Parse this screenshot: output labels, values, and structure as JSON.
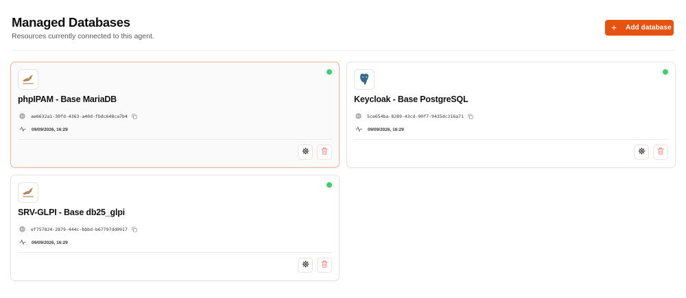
{
  "header": {
    "title": "Managed Databases",
    "subtitle": "Resources currently connected to this agent."
  },
  "toolbar": {
    "add_icon": "+",
    "add_label": "Add database"
  },
  "colors": {
    "accent": "#e8520f",
    "status_online": "#3fcf6d",
    "selected_border": "#e8b49c",
    "delete_icon": "#f0857a"
  },
  "databases": [
    {
      "name": "phpIPAM - Base MariaDB",
      "engine_icon": "mariadb-logo-icon",
      "id": "ae6632a1-30fd-4363-a40d-fbdc648ca7b4",
      "last_activity": "09/09/2026, 16:29",
      "status": "online",
      "selected": true
    },
    {
      "name": "Keycloak - Base PostgreSQL",
      "engine_icon": "postgresql-logo-icon",
      "id": "5ce654ba-8289-43cd-90f7-9435dc316a71",
      "last_activity": "09/09/2026, 16:29",
      "status": "online",
      "selected": false
    },
    {
      "name": "SRV-GLPI - Base db25_glpi",
      "engine_icon": "mariadb-logo-icon",
      "id": "ef757824-2879-444c-bbbd-b67797dd0917",
      "last_activity": "09/09/2026, 16:29",
      "status": "online",
      "selected": false
    }
  ]
}
